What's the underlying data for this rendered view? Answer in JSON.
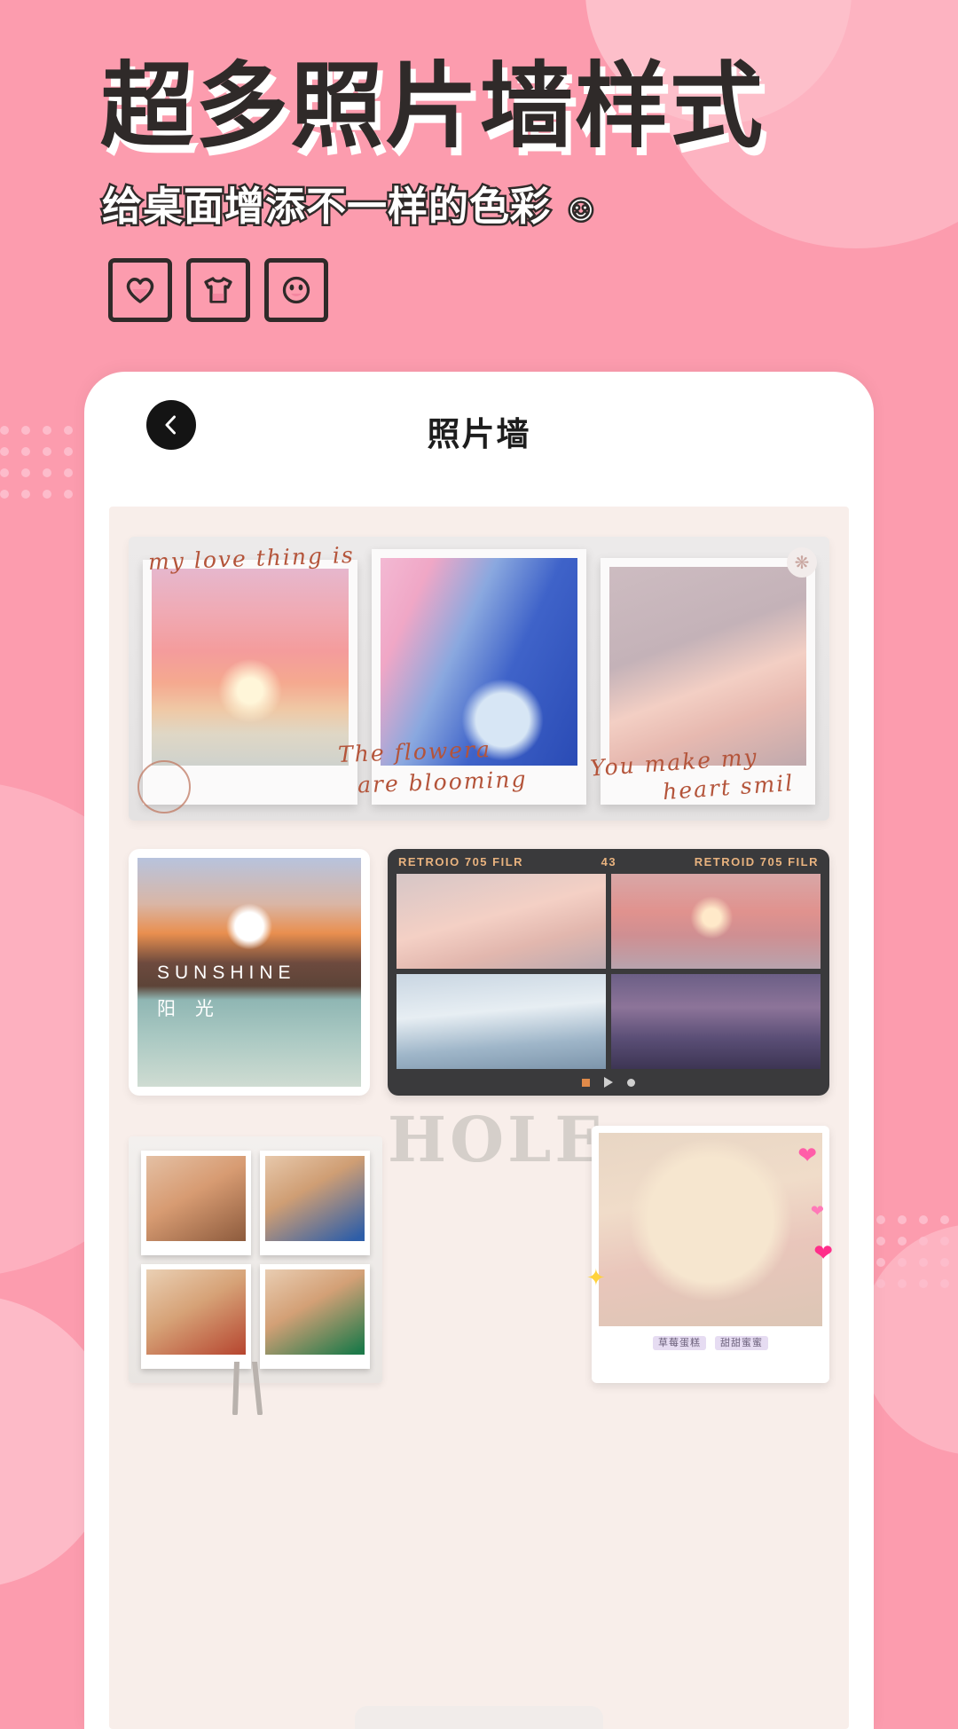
{
  "promo": {
    "headline": "超多照片墙样式",
    "subtitle": "给桌面增添不一样的色彩",
    "subtitle_emoji": "☺",
    "icons": [
      {
        "name": "heart-icon",
        "label": "♡"
      },
      {
        "name": "tshirt-icon",
        "label": "T"
      },
      {
        "name": "smiley-icon",
        "label": "☺"
      }
    ],
    "bg_color": "#fc9cae",
    "headline_color": "#2f2a29",
    "headline_shadow_color": "#ffffff"
  },
  "phone": {
    "nav": {
      "back_icon": "chevron-left-icon",
      "title": "照片墙"
    },
    "styles": {
      "trio": {
        "caption_top": "my love  thing  is",
        "caption_bottom_line1": "The   flowera",
        "caption_bottom_line2": "are   blooming",
        "caption_right_line1": "You   make   my",
        "caption_right_line2": "heart   smil",
        "stamp": "stamp-icon",
        "badge": "flower-icon",
        "photos": [
          "pink sunset beach",
          "moon and clouds",
          "pink snow mountain"
        ]
      },
      "sunshine": {
        "title_en": "SUNSHINE",
        "title_cn": "阳 光"
      },
      "film": {
        "label_left": "RETROIO  705  FILR",
        "label_center": "43",
        "label_right": "RETROID  705  FILR",
        "controls": [
          "stop-icon",
          "play-icon",
          "record-icon"
        ],
        "photos": [
          "snow mountain",
          "sunset sea",
          "swan on ice",
          "night sparkler"
        ]
      },
      "cats": {
        "overlay_text": "HOLE",
        "photos": [
          "cat with glasses",
          "cat with pepsi",
          "cat with cola",
          "cat with bottle"
        ]
      },
      "cake": {
        "tag_left": "草莓蛋糕",
        "tag_right": "甜甜蜜蜜",
        "stickers": [
          "heart-sticker",
          "heart-sticker",
          "star-sticker",
          "heart-sticker"
        ]
      }
    }
  }
}
